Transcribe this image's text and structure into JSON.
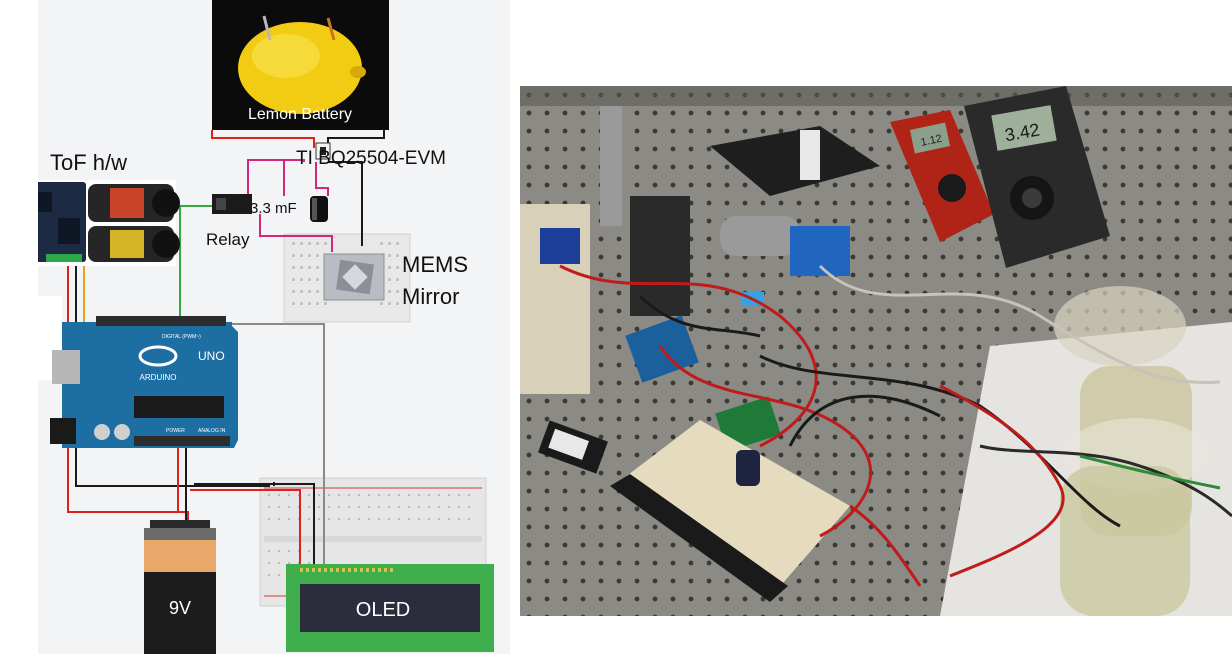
{
  "schematic": {
    "labels": {
      "lemon_battery": "Lemon Battery",
      "harvester": "TI BQ25504-EVM",
      "tof": "ToF h/w",
      "capacitor": "3.3 mF",
      "relay": "Relay",
      "mems_line1": "MEMS",
      "mems_line2": "Mirror",
      "battery": "9V",
      "oled": "OLED",
      "arduino_brand": "ARDUINO",
      "arduino_model": "UNO",
      "arduino_digital": "DIGITAL (PWM~)",
      "arduino_power": "POWER",
      "arduino_analog": "ANALOG IN"
    },
    "wire_colors": {
      "positive": "#e0201a",
      "ground": "#1a1a1a",
      "signal_pink": "#d4267a",
      "signal_green": "#3aa83a",
      "signal_gray": "#8a8a8a"
    }
  },
  "photo": {
    "meters": {
      "left_display": "1.12",
      "right_display": "3.42"
    }
  }
}
